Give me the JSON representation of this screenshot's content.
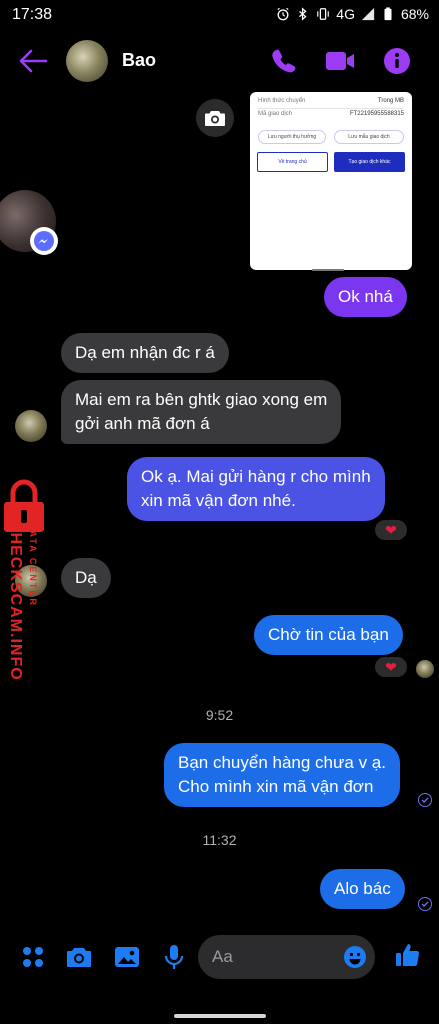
{
  "status_bar": {
    "time": "17:38",
    "network": "4G",
    "battery": "68%"
  },
  "header": {
    "contact_name": "Bao"
  },
  "image_message": {
    "rows": [
      {
        "label": "Hình thức chuyển",
        "value": "Trong MB"
      },
      {
        "label": "Mã giao dịch",
        "value": "FT22195955588315"
      }
    ],
    "pill_left": "Lưu người thụ hưởng",
    "pill_right": "Lưu mẫu giao dịch",
    "button_home": "Về trang chủ",
    "button_new": "Tạo giao dịch khác"
  },
  "messages": [
    {
      "id": "m1",
      "from": "me",
      "text": "Ok nhá"
    },
    {
      "id": "m2",
      "from": "them",
      "text": "Dạ em nhận đc r á"
    },
    {
      "id": "m3",
      "from": "them",
      "line1": "Mai em ra bên ghtk giao xong em",
      "line2": "gởi anh mã đơn á"
    },
    {
      "id": "m4",
      "from": "me",
      "line1": "Ok ạ. Mai gửi hàng r cho mình",
      "line2": "xin mã vận đơn nhé.",
      "reaction": "❤"
    },
    {
      "id": "m5",
      "from": "them",
      "text": "Dạ"
    },
    {
      "id": "m6",
      "from": "me",
      "text": "Chờ tin của bạn",
      "reaction": "❤"
    },
    {
      "id": "m7",
      "from": "me",
      "line1": "Bạn chuyển hàng chưa v ạ.",
      "line2": "Cho mình xin mã vận đơn"
    },
    {
      "id": "m8",
      "from": "me",
      "text": "Alo bác"
    }
  ],
  "timestamps": {
    "t1": "9:52",
    "t2": "11:32"
  },
  "watermark": {
    "brand": "CHECKSCAM.INFO",
    "sub": "DATA CENTER"
  },
  "composer": {
    "placeholder": "Aa"
  },
  "colors": {
    "accent_purple": "#7b36f0",
    "header_icon": "#9d3cf5",
    "bubble_in": "#3a3a3c",
    "bubble_blue": "#1d6ce8",
    "composer_icon": "#1e7cf2",
    "watermark_red": "#e22424"
  }
}
